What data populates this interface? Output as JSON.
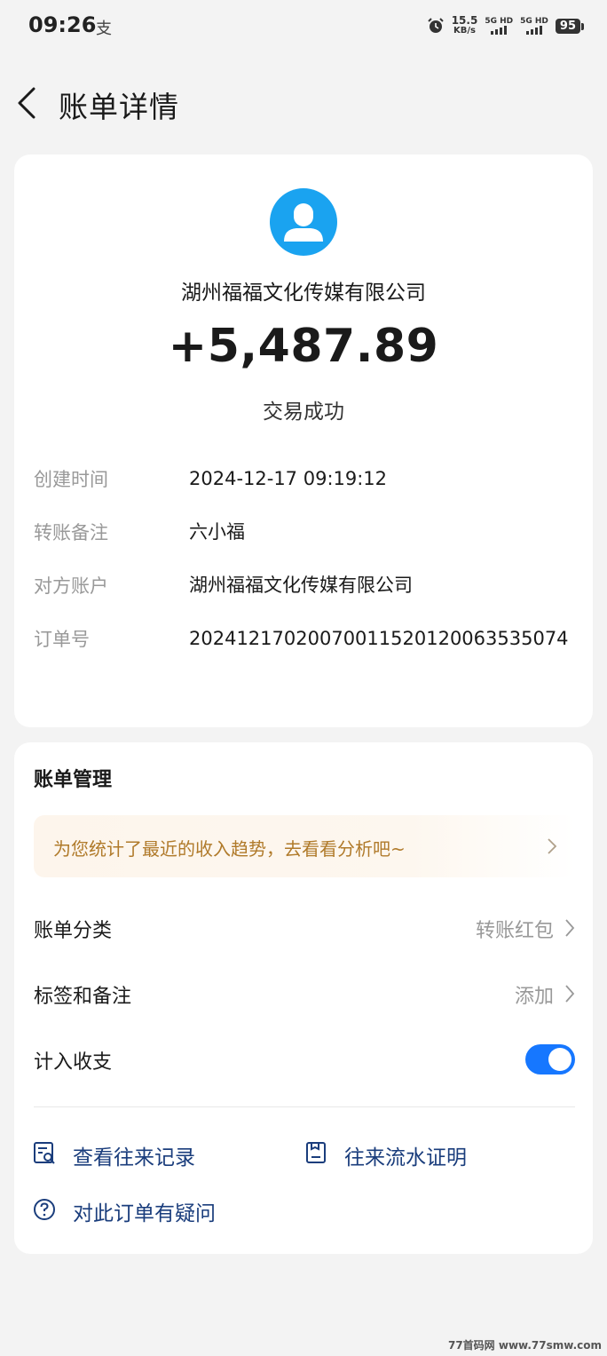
{
  "status_bar": {
    "time": "09:26",
    "app_icon": "支",
    "net_speed_value": "15.5",
    "net_speed_unit": "KB/s",
    "signal1_label": "5G HD",
    "signal2_label": "5G HD",
    "battery": "95"
  },
  "header": {
    "title": "账单详情"
  },
  "transaction": {
    "counterparty": "湖州福福文化传媒有限公司",
    "amount": "+5,487.89",
    "status": "交易成功",
    "details": [
      {
        "label": "创建时间",
        "value": "2024-12-17 09:19:12"
      },
      {
        "label": "转账备注",
        "value": "六小福"
      },
      {
        "label": "对方账户",
        "value": "湖州福福文化传媒有限公司"
      },
      {
        "label": "订单号",
        "value": "20241217020070011520120063535074"
      }
    ]
  },
  "manage": {
    "title": "账单管理",
    "tip": "为您统计了最近的收入趋势，去看看分析吧~",
    "category_label": "账单分类",
    "category_value": "转账红包",
    "tag_label": "标签和备注",
    "tag_value": "添加",
    "count_label": "计入收支",
    "count_enabled": true,
    "link_history": "查看往来记录",
    "link_proof": "往来流水证明",
    "link_question": "对此订单有疑问"
  },
  "watermark": "77首码网 www.77smw.com",
  "colors": {
    "accent_blue": "#1677ff",
    "avatar_blue": "#1aa3f0",
    "tip_text": "#b07a2a",
    "link_text": "#1a3d7c"
  }
}
